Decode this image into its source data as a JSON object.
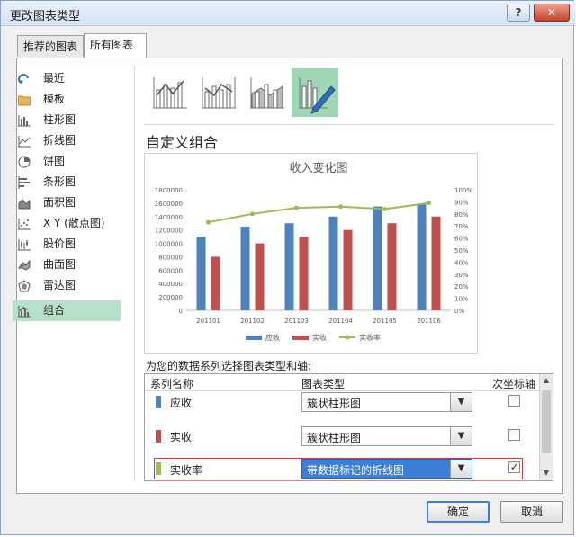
{
  "window": {
    "title": "更改图表类型",
    "help_label": "?",
    "close_label": "✕"
  },
  "tabs": [
    {
      "label": "推荐的图表"
    },
    {
      "label": "所有图表"
    }
  ],
  "sidebar": {
    "items": [
      {
        "label": "最近",
        "icon": "recent-icon"
      },
      {
        "label": "模板",
        "icon": "folder-icon"
      },
      {
        "label": "柱形图",
        "icon": "column-chart-icon"
      },
      {
        "label": "折线图",
        "icon": "line-chart-icon"
      },
      {
        "label": "饼图",
        "icon": "pie-chart-icon"
      },
      {
        "label": "条形图",
        "icon": "bar-chart-icon"
      },
      {
        "label": "面积图",
        "icon": "area-chart-icon"
      },
      {
        "label": "X Y (散点图)",
        "icon": "scatter-chart-icon"
      },
      {
        "label": "股价图",
        "icon": "stock-chart-icon"
      },
      {
        "label": "曲面图",
        "icon": "surface-chart-icon"
      },
      {
        "label": "雷达图",
        "icon": "radar-chart-icon"
      },
      {
        "label": "组合",
        "icon": "combo-chart-icon",
        "selected": true
      }
    ]
  },
  "chart_types": [
    "clustered-column-line-icon",
    "clustered-column-line-secondary-icon",
    "stacked-area-column-icon",
    "custom-combo-icon"
  ],
  "section": {
    "heading": "自定义组合"
  },
  "chart_data": {
    "type": "bar",
    "title": "收入变化图",
    "categories": [
      "201101",
      "201102",
      "201103",
      "201104",
      "201105",
      "201106"
    ],
    "y_ticks": [
      "1800000",
      "1600000",
      "1400000",
      "1200000",
      "1000000",
      "800000",
      "600000",
      "400000",
      "200000",
      "0"
    ],
    "y2_ticks": [
      "100%",
      "90%",
      "80%",
      "70%",
      "60%",
      "50%",
      "40%",
      "30%",
      "20%",
      "10%",
      "0%"
    ],
    "ylim": [
      0,
      1800000
    ],
    "y2lim": [
      0,
      1
    ],
    "series": [
      {
        "name": "应收",
        "type": "bar",
        "color": "#4f81bd",
        "values": [
          1100000,
          1250000,
          1300000,
          1400000,
          1550000,
          1580000
        ]
      },
      {
        "name": "实收",
        "type": "bar",
        "color": "#c0504d",
        "values": [
          800000,
          1000000,
          1100000,
          1200000,
          1300000,
          1400000
        ]
      },
      {
        "name": "实收率",
        "type": "line",
        "axis": "secondary",
        "color": "#9bbb59",
        "values": [
          0.73,
          0.8,
          0.85,
          0.86,
          0.84,
          0.89
        ]
      }
    ],
    "legend": "bottom"
  },
  "series_section": {
    "prompt": "为您的数据系列选择图表类型和轴:",
    "headers": {
      "name": "系列名称",
      "type": "图表类型",
      "axis": "次坐标轴"
    },
    "rows": [
      {
        "name": "应收",
        "color": "#4f81bd",
        "type": "簇状柱形图",
        "secondary": false
      },
      {
        "name": "实收",
        "color": "#c0504d",
        "type": "簇状柱形图",
        "secondary": false
      },
      {
        "name": "实收率",
        "color": "#9bbb59",
        "type": "带数据标记的折线图",
        "secondary": true
      }
    ]
  },
  "buttons": {
    "ok": "确定",
    "cancel": "取消"
  }
}
